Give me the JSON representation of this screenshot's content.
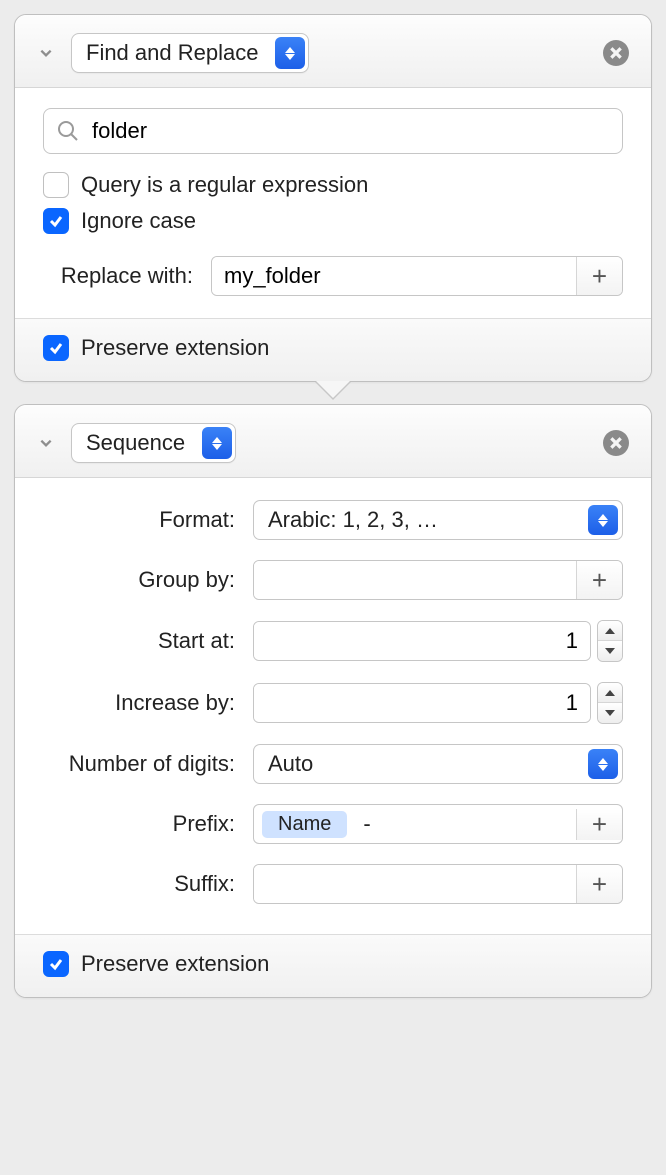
{
  "panel1": {
    "mode": "Find and Replace",
    "search_value": "folder",
    "regex_label": "Query is a regular expression",
    "regex_checked": false,
    "ignore_case_label": "Ignore case",
    "ignore_case_checked": true,
    "replace_label": "Replace with:",
    "replace_value": "my_folder",
    "preserve_ext_label": "Preserve extension",
    "preserve_ext_checked": true
  },
  "panel2": {
    "mode": "Sequence",
    "format_label": "Format:",
    "format_value": "Arabic: 1, 2, 3, …",
    "group_label": "Group by:",
    "group_value": "",
    "start_label": "Start at:",
    "start_value": "1",
    "increase_label": "Increase by:",
    "increase_value": "1",
    "digits_label": "Number of digits:",
    "digits_value": "Auto",
    "prefix_label": "Prefix:",
    "prefix_token": "Name",
    "prefix_rest": "-",
    "suffix_label": "Suffix:",
    "suffix_value": "",
    "preserve_ext_label": "Preserve extension",
    "preserve_ext_checked": true
  }
}
